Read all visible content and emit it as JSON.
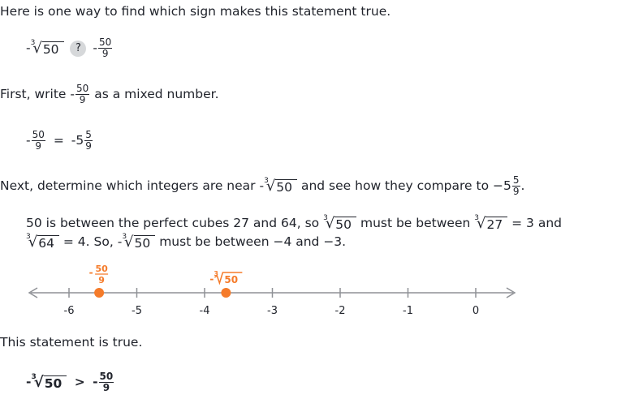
{
  "intro": "Here is one way to find which sign makes this statement true.",
  "problem": {
    "neg": "-",
    "root_index": "3",
    "radicand": "50",
    "placeholder": "?",
    "rhs_neg": "-",
    "rhs_num": "50",
    "rhs_den": "9"
  },
  "step1": {
    "before": "First, write",
    "neg": "-",
    "num": "50",
    "den": "9",
    "after": "as a mixed number."
  },
  "mixed": {
    "lhs_neg": "-",
    "lhs_num": "50",
    "lhs_den": "9",
    "equals": "=",
    "rhs_neg": "-",
    "whole": "5",
    "num": "5",
    "den": "9"
  },
  "step2": {
    "before": "Next, determine which integers are near",
    "neg": "-",
    "root_index": "3",
    "radicand": "50",
    "middle": "and see how they compare to",
    "neg2": "−",
    "whole": "5",
    "num": "5",
    "den": "9",
    "end": "."
  },
  "explain": {
    "a": "50 is between the perfect cubes 27 and 64, so",
    "r1": "50",
    "b": "must be between",
    "r2": "27",
    "c": "= 3 and",
    "r3": "64",
    "d": "= 4. So,",
    "neg": "-",
    "r4": "50",
    "e": "must be between −4 and −3.",
    "idx": "3"
  },
  "number_line": {
    "ticks": [
      "-6",
      "-5",
      "-4",
      "-3",
      "-2",
      "-1",
      "0"
    ],
    "min": -6,
    "max": 0,
    "points": [
      {
        "label_neg": "-",
        "label_num": "50",
        "label_den": "9",
        "value": -5.5556
      },
      {
        "label_neg": "-",
        "label_idx": "3",
        "label_rad": "50",
        "value": -3.684
      }
    ],
    "point_color": "#f57b2a"
  },
  "conclusion": "This statement is true.",
  "final": {
    "neg": "-",
    "root_index": "3",
    "radicand": "50",
    "sign": ">",
    "rhs_neg": "-",
    "rhs_num": "50",
    "rhs_den": "9"
  }
}
